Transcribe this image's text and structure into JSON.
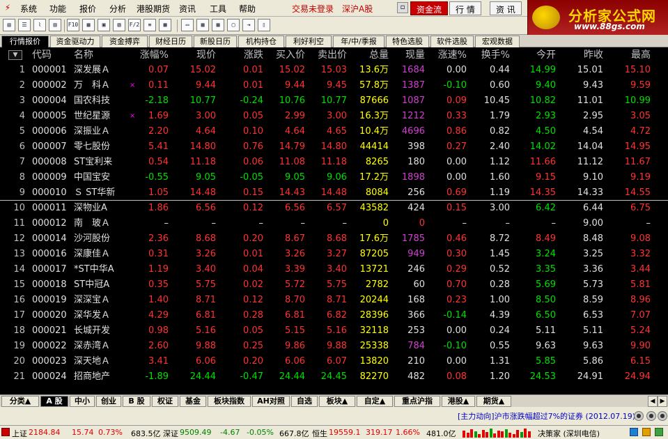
{
  "menubar": {
    "items": [
      "系统",
      "功能",
      "报价",
      "分析",
      "港股期货",
      "资讯",
      "工具",
      "帮助"
    ],
    "trade_status": "交易未登录",
    "market_status": "深沪A股",
    "tabs": [
      "资金流",
      "行 情",
      "资 讯"
    ],
    "active_tab": "资金流"
  },
  "logo": {
    "title": "分析家公式网",
    "url": "www.88gs.com"
  },
  "toolbar": {
    "icons": [
      "quote-icon",
      "list-icon",
      "chart-icon",
      "bar-chart-icon",
      "f10-icon",
      "f10-doc-icon",
      "news-icon",
      "fund-icon",
      "f10-doc-icon",
      "formula-icon",
      "folder-icon",
      "export-icon",
      "window-icon"
    ]
  },
  "top_tabs": [
    "行情报价",
    "资金驱动力",
    "资金搏弈",
    "财经日历",
    "新股日历",
    "机构持仓",
    "利好利空",
    "年/中/季报",
    "特色选股",
    "软件选股",
    "宏观数据"
  ],
  "table": {
    "headers": [
      "代码",
      "名称",
      "涨幅%",
      "现价",
      "涨跌",
      "买入价",
      "卖出价",
      "总量",
      "现量",
      "涨速%",
      "换手%",
      "今开",
      "昨收",
      "最高"
    ],
    "rows": [
      {
        "n": "1",
        "code": "000001",
        "name": "深发展Ａ",
        "mark": "",
        "chg": "0.07",
        "price": "15.02",
        "diff": "0.01",
        "buy": "15.02",
        "sell": "15.03",
        "vol": "13.6万",
        "cur": "1684",
        "speed": "0.00",
        "turn": "0.44",
        "open": "14.99",
        "prev": "15.01",
        "high": "15.10"
      },
      {
        "n": "2",
        "code": "000002",
        "name": "万　科Ａ",
        "mark": "×",
        "chg": "0.11",
        "price": "9.44",
        "diff": "0.01",
        "buy": "9.44",
        "sell": "9.45",
        "vol": "57.8万",
        "cur": "1387",
        "speed": "-0.10",
        "turn": "0.60",
        "open": "9.40",
        "prev": "9.43",
        "high": "9.59"
      },
      {
        "n": "3",
        "code": "000004",
        "name": "国农科技",
        "mark": "",
        "chg": "-2.18",
        "price": "10.77",
        "diff": "-0.24",
        "buy": "10.76",
        "sell": "10.77",
        "vol": "87666",
        "cur": "1087",
        "speed": "0.09",
        "turn": "10.45",
        "open": "10.82",
        "prev": "11.01",
        "high": "10.99"
      },
      {
        "n": "4",
        "code": "000005",
        "name": "世纪星源",
        "mark": "×",
        "chg": "1.69",
        "price": "3.00",
        "diff": "0.05",
        "buy": "2.99",
        "sell": "3.00",
        "vol": "16.3万",
        "cur": "1212",
        "speed": "0.33",
        "turn": "1.79",
        "open": "2.93",
        "prev": "2.95",
        "high": "3.05"
      },
      {
        "n": "5",
        "code": "000006",
        "name": "深振业Ａ",
        "mark": "",
        "chg": "2.20",
        "price": "4.64",
        "diff": "0.10",
        "buy": "4.64",
        "sell": "4.65",
        "vol": "10.4万",
        "cur": "4696",
        "speed": "0.86",
        "turn": "0.82",
        "open": "4.50",
        "prev": "4.54",
        "high": "4.72"
      },
      {
        "n": "6",
        "code": "000007",
        "name": "零七股份",
        "mark": "",
        "chg": "5.41",
        "price": "14.80",
        "diff": "0.76",
        "buy": "14.79",
        "sell": "14.80",
        "vol": "44414",
        "cur": "398",
        "speed": "0.27",
        "turn": "2.40",
        "open": "14.02",
        "prev": "14.04",
        "high": "14.95"
      },
      {
        "n": "7",
        "code": "000008",
        "name": "ST宝利来",
        "mark": "",
        "chg": "0.54",
        "price": "11.18",
        "diff": "0.06",
        "buy": "11.08",
        "sell": "11.18",
        "vol": "8265",
        "cur": "180",
        "speed": "0.00",
        "turn": "1.12",
        "open": "11.66",
        "prev": "11.12",
        "high": "11.67"
      },
      {
        "n": "8",
        "code": "000009",
        "name": "中国宝安",
        "mark": "",
        "chg": "-0.55",
        "price": "9.05",
        "diff": "-0.05",
        "buy": "9.05",
        "sell": "9.06",
        "vol": "17.2万",
        "cur": "1898",
        "speed": "0.00",
        "turn": "1.60",
        "open": "9.15",
        "prev": "9.10",
        "high": "9.19"
      },
      {
        "n": "9",
        "code": "000010",
        "name": "Ｓ ST华新",
        "mark": "",
        "chg": "1.05",
        "price": "14.48",
        "diff": "0.15",
        "buy": "14.43",
        "sell": "14.48",
        "vol": "8084",
        "cur": "256",
        "speed": "0.69",
        "turn": "1.19",
        "open": "14.35",
        "prev": "14.33",
        "high": "14.55"
      },
      {
        "n": "10",
        "code": "000011",
        "name": "深物业A",
        "mark": "",
        "chg": "1.86",
        "price": "6.56",
        "diff": "0.12",
        "buy": "6.56",
        "sell": "6.57",
        "vol": "43582",
        "cur": "424",
        "speed": "0.15",
        "turn": "3.00",
        "open": "6.42",
        "prev": "6.44",
        "high": "6.75"
      },
      {
        "n": "11",
        "code": "000012",
        "name": "南　玻Ａ",
        "mark": "",
        "chg": "–",
        "price": "–",
        "diff": "–",
        "buy": "–",
        "sell": "–",
        "vol": "0",
        "cur": "0",
        "speed": "–",
        "turn": "–",
        "open": "–",
        "prev": "9.00",
        "high": "–"
      },
      {
        "n": "12",
        "code": "000014",
        "name": "沙河股份",
        "mark": "",
        "chg": "2.36",
        "price": "8.68",
        "diff": "0.20",
        "buy": "8.67",
        "sell": "8.68",
        "vol": "17.6万",
        "cur": "1785",
        "speed": "0.46",
        "turn": "8.72",
        "open": "8.49",
        "prev": "8.48",
        "high": "9.08"
      },
      {
        "n": "13",
        "code": "000016",
        "name": "深康佳Ａ",
        "mark": "",
        "chg": "0.31",
        "price": "3.26",
        "diff": "0.01",
        "buy": "3.26",
        "sell": "3.27",
        "vol": "87205",
        "cur": "949",
        "speed": "0.30",
        "turn": "1.45",
        "open": "3.24",
        "prev": "3.25",
        "high": "3.32"
      },
      {
        "n": "14",
        "code": "000017",
        "name": "*ST中华A",
        "mark": "",
        "chg": "1.19",
        "price": "3.40",
        "diff": "0.04",
        "buy": "3.39",
        "sell": "3.40",
        "vol": "13721",
        "cur": "246",
        "speed": "0.29",
        "turn": "0.52",
        "open": "3.35",
        "prev": "3.36",
        "high": "3.44"
      },
      {
        "n": "15",
        "code": "000018",
        "name": "ST中冠A",
        "mark": "",
        "chg": "0.35",
        "price": "5.75",
        "diff": "0.02",
        "buy": "5.72",
        "sell": "5.75",
        "vol": "2782",
        "cur": "60",
        "speed": "0.70",
        "turn": "0.28",
        "open": "5.69",
        "prev": "5.73",
        "high": "5.81"
      },
      {
        "n": "16",
        "code": "000019",
        "name": "深深宝Ａ",
        "mark": "",
        "chg": "1.40",
        "price": "8.71",
        "diff": "0.12",
        "buy": "8.70",
        "sell": "8.71",
        "vol": "20244",
        "cur": "168",
        "speed": "0.23",
        "turn": "1.00",
        "open": "8.50",
        "prev": "8.59",
        "high": "8.96"
      },
      {
        "n": "17",
        "code": "000020",
        "name": "深华发Ａ",
        "mark": "",
        "chg": "4.29",
        "price": "6.81",
        "diff": "0.28",
        "buy": "6.81",
        "sell": "6.82",
        "vol": "28396",
        "cur": "366",
        "speed": "-0.14",
        "turn": "4.39",
        "open": "6.50",
        "prev": "6.53",
        "high": "7.07"
      },
      {
        "n": "18",
        "code": "000021",
        "name": "长城开发",
        "mark": "",
        "chg": "0.98",
        "price": "5.16",
        "diff": "0.05",
        "buy": "5.15",
        "sell": "5.16",
        "vol": "32118",
        "cur": "253",
        "speed": "0.00",
        "turn": "0.24",
        "open": "5.11",
        "prev": "5.11",
        "high": "5.24"
      },
      {
        "n": "19",
        "code": "000022",
        "name": "深赤湾Ａ",
        "mark": "",
        "chg": "2.60",
        "price": "9.88",
        "diff": "0.25",
        "buy": "9.86",
        "sell": "9.88",
        "vol": "25338",
        "cur": "784",
        "speed": "-0.10",
        "turn": "0.55",
        "open": "9.63",
        "prev": "9.63",
        "high": "9.90"
      },
      {
        "n": "20",
        "code": "000023",
        "name": "深天地Ａ",
        "mark": "",
        "chg": "3.41",
        "price": "6.06",
        "diff": "0.20",
        "buy": "6.06",
        "sell": "6.07",
        "vol": "13820",
        "cur": "210",
        "speed": "0.00",
        "turn": "1.31",
        "open": "5.85",
        "prev": "5.86",
        "high": "6.15"
      },
      {
        "n": "21",
        "code": "000024",
        "name": "招商地产",
        "mark": "",
        "chg": "-1.89",
        "price": "24.44",
        "diff": "-0.47",
        "buy": "24.44",
        "sell": "24.45",
        "vol": "82270",
        "cur": "482",
        "speed": "0.08",
        "turn": "1.20",
        "open": "24.53",
        "prev": "24.91",
        "high": "24.94"
      }
    ]
  },
  "bottom_tabs": [
    "分类▲",
    "A 股",
    "中小",
    "创业",
    "B 股",
    "权证",
    "基金",
    "板块指数",
    "AH对照",
    "自选",
    "板块▲",
    "自定▲",
    "重点沪指",
    "港股▲",
    "期货▲"
  ],
  "news": {
    "text": "[主力动向]沪市涨跌幅超过7%的证券 (2012.07.19)"
  },
  "statusbar": {
    "sh_label": "上证",
    "sh_value": "2184.84",
    "sh_diff": "15.74",
    "sh_pct": "0.73%",
    "sh_amount": "683.5亿",
    "sz_label": "深证",
    "sz_value": "9509.49",
    "sz_diff": "-4.67",
    "sz_pct": "-0.05%",
    "sz_amount": "667.8亿",
    "hs_label": "恒生",
    "hs_value": "19559.1",
    "hs_diff": "319.17",
    "hs_pct": "1.66%",
    "hs_amount": "481.0亿",
    "broker": "决策家 (深圳电信)"
  },
  "colors": {
    "up": "#ff3333",
    "down": "#00e000",
    "volume": "#ffff00",
    "highlight": "#d040d0",
    "menu_accent": "#c80000"
  }
}
